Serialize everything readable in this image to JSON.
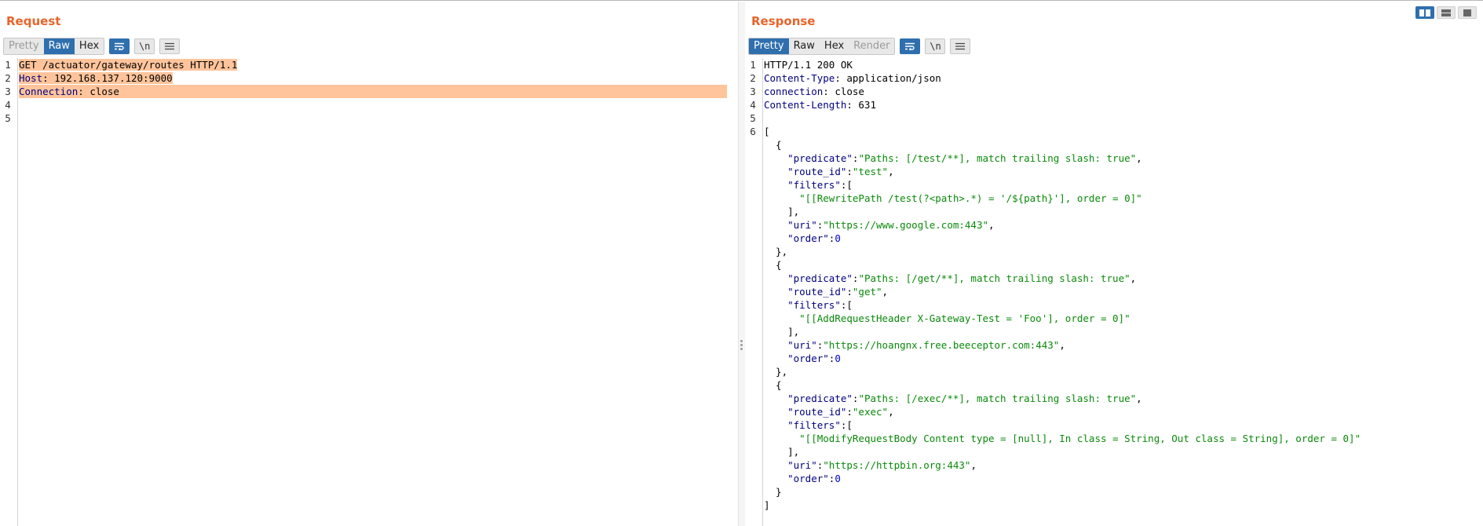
{
  "request": {
    "title": "Request",
    "tabs": [
      "Pretty",
      "Raw",
      "Hex"
    ],
    "active_tab": "Raw",
    "newline_label": "\\n",
    "lines": [
      {
        "n": "1",
        "parts": [
          {
            "t": "GET /actuator/gateway/routes HTTP/1.1",
            "c": ""
          }
        ]
      },
      {
        "n": "2",
        "parts": [
          {
            "t": "Host",
            "c": "k"
          },
          {
            "t": ": 192.168.137.120:9000",
            "c": ""
          }
        ]
      },
      {
        "n": "3",
        "parts": [
          {
            "t": "Connection",
            "c": "k"
          },
          {
            "t": ": close",
            "c": ""
          }
        ]
      },
      {
        "n": "4",
        "parts": []
      },
      {
        "n": "5",
        "parts": []
      }
    ]
  },
  "response": {
    "title": "Response",
    "tabs": [
      "Pretty",
      "Raw",
      "Hex",
      "Render"
    ],
    "active_tab": "Pretty",
    "newline_label": "\\n",
    "lines": [
      {
        "n": "1",
        "parts": [
          {
            "t": "HTTP/1.1 200 OK",
            "c": ""
          }
        ]
      },
      {
        "n": "2",
        "parts": [
          {
            "t": "Content-Type",
            "c": "k"
          },
          {
            "t": ": application/json",
            "c": ""
          }
        ]
      },
      {
        "n": "3",
        "parts": [
          {
            "t": "connection",
            "c": "k"
          },
          {
            "t": ": close",
            "c": ""
          }
        ]
      },
      {
        "n": "4",
        "parts": [
          {
            "t": "Content-Length",
            "c": "k"
          },
          {
            "t": ": 631",
            "c": ""
          }
        ]
      },
      {
        "n": "5",
        "parts": []
      },
      {
        "n": "6",
        "parts": [
          {
            "t": "[",
            "c": ""
          }
        ]
      },
      {
        "n": "",
        "parts": [
          {
            "t": "  {",
            "c": ""
          }
        ]
      },
      {
        "n": "",
        "parts": [
          {
            "t": "    ",
            "c": ""
          },
          {
            "t": "\"predicate\"",
            "c": "k"
          },
          {
            "t": ":",
            "c": ""
          },
          {
            "t": "\"Paths: [/test/**], match trailing slash: true\"",
            "c": "s"
          },
          {
            "t": ",",
            "c": ""
          }
        ]
      },
      {
        "n": "",
        "parts": [
          {
            "t": "    ",
            "c": ""
          },
          {
            "t": "\"route_id\"",
            "c": "k"
          },
          {
            "t": ":",
            "c": ""
          },
          {
            "t": "\"test\"",
            "c": "s"
          },
          {
            "t": ",",
            "c": ""
          }
        ]
      },
      {
        "n": "",
        "parts": [
          {
            "t": "    ",
            "c": ""
          },
          {
            "t": "\"filters\"",
            "c": "k"
          },
          {
            "t": ":[",
            "c": ""
          }
        ]
      },
      {
        "n": "",
        "parts": [
          {
            "t": "      ",
            "c": ""
          },
          {
            "t": "\"[[RewritePath /test(?<path>.*) = '/${path}'], order = 0]\"",
            "c": "s"
          }
        ]
      },
      {
        "n": "",
        "parts": [
          {
            "t": "    ],",
            "c": ""
          }
        ]
      },
      {
        "n": "",
        "parts": [
          {
            "t": "    ",
            "c": ""
          },
          {
            "t": "\"uri\"",
            "c": "k"
          },
          {
            "t": ":",
            "c": ""
          },
          {
            "t": "\"https://www.google.com:443\"",
            "c": "s"
          },
          {
            "t": ",",
            "c": ""
          }
        ]
      },
      {
        "n": "",
        "parts": [
          {
            "t": "    ",
            "c": ""
          },
          {
            "t": "\"order\"",
            "c": "k"
          },
          {
            "t": ":",
            "c": ""
          },
          {
            "t": "0",
            "c": "n"
          }
        ]
      },
      {
        "n": "",
        "parts": [
          {
            "t": "  },",
            "c": ""
          }
        ]
      },
      {
        "n": "",
        "parts": [
          {
            "t": "  {",
            "c": ""
          }
        ]
      },
      {
        "n": "",
        "parts": [
          {
            "t": "    ",
            "c": ""
          },
          {
            "t": "\"predicate\"",
            "c": "k"
          },
          {
            "t": ":",
            "c": ""
          },
          {
            "t": "\"Paths: [/get/**], match trailing slash: true\"",
            "c": "s"
          },
          {
            "t": ",",
            "c": ""
          }
        ]
      },
      {
        "n": "",
        "parts": [
          {
            "t": "    ",
            "c": ""
          },
          {
            "t": "\"route_id\"",
            "c": "k"
          },
          {
            "t": ":",
            "c": ""
          },
          {
            "t": "\"get\"",
            "c": "s"
          },
          {
            "t": ",",
            "c": ""
          }
        ]
      },
      {
        "n": "",
        "parts": [
          {
            "t": "    ",
            "c": ""
          },
          {
            "t": "\"filters\"",
            "c": "k"
          },
          {
            "t": ":[",
            "c": ""
          }
        ]
      },
      {
        "n": "",
        "parts": [
          {
            "t": "      ",
            "c": ""
          },
          {
            "t": "\"[[AddRequestHeader X-Gateway-Test = 'Foo'], order = 0]\"",
            "c": "s"
          }
        ]
      },
      {
        "n": "",
        "parts": [
          {
            "t": "    ],",
            "c": ""
          }
        ]
      },
      {
        "n": "",
        "parts": [
          {
            "t": "    ",
            "c": ""
          },
          {
            "t": "\"uri\"",
            "c": "k"
          },
          {
            "t": ":",
            "c": ""
          },
          {
            "t": "\"https://hoangnx.free.beeceptor.com:443\"",
            "c": "s"
          },
          {
            "t": ",",
            "c": ""
          }
        ]
      },
      {
        "n": "",
        "parts": [
          {
            "t": "    ",
            "c": ""
          },
          {
            "t": "\"order\"",
            "c": "k"
          },
          {
            "t": ":",
            "c": ""
          },
          {
            "t": "0",
            "c": "n"
          }
        ]
      },
      {
        "n": "",
        "parts": [
          {
            "t": "  },",
            "c": ""
          }
        ]
      },
      {
        "n": "",
        "parts": [
          {
            "t": "  {",
            "c": ""
          }
        ]
      },
      {
        "n": "",
        "parts": [
          {
            "t": "    ",
            "c": ""
          },
          {
            "t": "\"predicate\"",
            "c": "k"
          },
          {
            "t": ":",
            "c": ""
          },
          {
            "t": "\"Paths: [/exec/**], match trailing slash: true\"",
            "c": "s"
          },
          {
            "t": ",",
            "c": ""
          }
        ]
      },
      {
        "n": "",
        "parts": [
          {
            "t": "    ",
            "c": ""
          },
          {
            "t": "\"route_id\"",
            "c": "k"
          },
          {
            "t": ":",
            "c": ""
          },
          {
            "t": "\"exec\"",
            "c": "s"
          },
          {
            "t": ",",
            "c": ""
          }
        ]
      },
      {
        "n": "",
        "parts": [
          {
            "t": "    ",
            "c": ""
          },
          {
            "t": "\"filters\"",
            "c": "k"
          },
          {
            "t": ":[",
            "c": ""
          }
        ]
      },
      {
        "n": "",
        "parts": [
          {
            "t": "      ",
            "c": ""
          },
          {
            "t": "\"[[ModifyRequestBody Content type = [null], In class = String, Out class = String], order = 0]\"",
            "c": "s"
          }
        ]
      },
      {
        "n": "",
        "parts": [
          {
            "t": "    ],",
            "c": ""
          }
        ]
      },
      {
        "n": "",
        "parts": [
          {
            "t": "    ",
            "c": ""
          },
          {
            "t": "\"uri\"",
            "c": "k"
          },
          {
            "t": ":",
            "c": ""
          },
          {
            "t": "\"https://httpbin.org:443\"",
            "c": "s"
          },
          {
            "t": ",",
            "c": ""
          }
        ]
      },
      {
        "n": "",
        "parts": [
          {
            "t": "    ",
            "c": ""
          },
          {
            "t": "\"order\"",
            "c": "k"
          },
          {
            "t": ":",
            "c": ""
          },
          {
            "t": "0",
            "c": "n"
          }
        ]
      },
      {
        "n": "",
        "parts": [
          {
            "t": "  }",
            "c": ""
          }
        ]
      },
      {
        "n": "",
        "parts": [
          {
            "t": "]",
            "c": ""
          }
        ]
      }
    ]
  },
  "icons": {
    "wrap": "word-wrap-icon",
    "menu": "hamburger-menu-icon",
    "layout_split": "split-layout-icon",
    "layout_horizontal": "horizontal-layout-icon",
    "layout_single": "single-pane-icon"
  },
  "colors": {
    "title": "#e8642a",
    "active_button": "#2f6fae",
    "selection": "#ffc49b",
    "header_name": "#000080",
    "json_string": "#0a8a0a",
    "json_number": "#0000e0"
  }
}
